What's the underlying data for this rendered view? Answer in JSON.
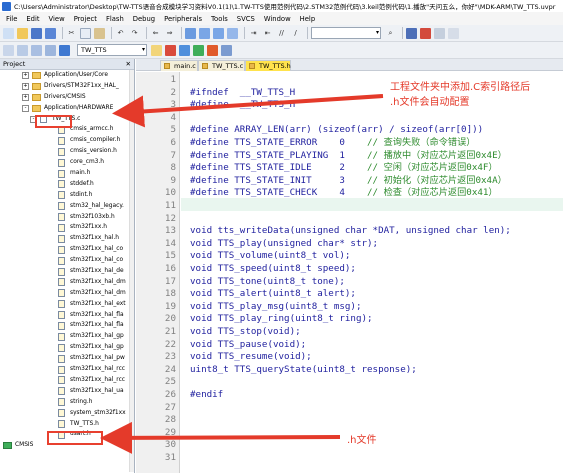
{
  "window": {
    "title": "C:\\Users\\Administrator\\Desktop\\TW-TTS语音合成模块学习资料V0.1(1)\\1.TW-TTS使用范例代码\\2.STM32范例代码\\3.keil范例代码\\1.播放\"天问五么，你好\"\\MDK-ARM\\TW_TTS.uvpr"
  },
  "menu": [
    "File",
    "Edit",
    "View",
    "Project",
    "Flash",
    "Debug",
    "Peripherals",
    "Tools",
    "SVCS",
    "Window",
    "Help"
  ],
  "toolbar": {
    "target": "TW_TTS"
  },
  "project": {
    "title": "Project",
    "items": [
      {
        "label": "Application/User/Core",
        "kind": "folder",
        "level": 2,
        "expander": "+"
      },
      {
        "label": "Drivers/STM32F1xx_HAL_",
        "kind": "folder",
        "level": 2,
        "expander": "+"
      },
      {
        "label": "Drivers/CMSIS",
        "kind": "folder",
        "level": 2,
        "expander": "+"
      },
      {
        "label": "Application/HARDWARE",
        "kind": "folder",
        "level": 2,
        "expander": "-"
      },
      {
        "label": "TW_TTS.c",
        "kind": "file",
        "level": 3,
        "expander": "-"
      },
      {
        "label": "cmsis_armcc.h",
        "kind": "hfile",
        "level": 5
      },
      {
        "label": "cmsis_compiler.h",
        "kind": "hfile",
        "level": 5
      },
      {
        "label": "cmsis_version.h",
        "kind": "hfile",
        "level": 5
      },
      {
        "label": "core_cm3.h",
        "kind": "hfile",
        "level": 5
      },
      {
        "label": "main.h",
        "kind": "hfile",
        "level": 5
      },
      {
        "label": "stddef.h",
        "kind": "hfile",
        "level": 5
      },
      {
        "label": "stdint.h",
        "kind": "hfile",
        "level": 5
      },
      {
        "label": "stm32_hal_legacy.",
        "kind": "hfile",
        "level": 5
      },
      {
        "label": "stm32f103xb.h",
        "kind": "hfile",
        "level": 5
      },
      {
        "label": "stm32f1xx.h",
        "kind": "hfile",
        "level": 5
      },
      {
        "label": "stm32f1xx_hal.h",
        "kind": "hfile",
        "level": 5
      },
      {
        "label": "stm32f1xx_hal_co",
        "kind": "hfile",
        "level": 5
      },
      {
        "label": "stm32f1xx_hal_co",
        "kind": "hfile",
        "level": 5
      },
      {
        "label": "stm32f1xx_hal_de",
        "kind": "hfile",
        "level": 5
      },
      {
        "label": "stm32f1xx_hal_dm",
        "kind": "hfile",
        "level": 5
      },
      {
        "label": "stm32f1xx_hal_dm",
        "kind": "hfile",
        "level": 5
      },
      {
        "label": "stm32f1xx_hal_ext",
        "kind": "hfile",
        "level": 5
      },
      {
        "label": "stm32f1xx_hal_fla",
        "kind": "hfile",
        "level": 5
      },
      {
        "label": "stm32f1xx_hal_fla",
        "kind": "hfile",
        "level": 5
      },
      {
        "label": "stm32f1xx_hal_gp",
        "kind": "hfile",
        "level": 5
      },
      {
        "label": "stm32f1xx_hal_gp",
        "kind": "hfile",
        "level": 5
      },
      {
        "label": "stm32f1xx_hal_pw",
        "kind": "hfile",
        "level": 5
      },
      {
        "label": "stm32f1xx_hal_rcc",
        "kind": "hfile",
        "level": 5
      },
      {
        "label": "stm32f1xx_hal_rcc",
        "kind": "hfile",
        "level": 5
      },
      {
        "label": "stm32f1xx_hal_ua",
        "kind": "hfile",
        "level": 5
      },
      {
        "label": "string.h",
        "kind": "hfile",
        "level": 5
      },
      {
        "label": "system_stm32f1xx",
        "kind": "hfile",
        "level": 5
      },
      {
        "label": "TW_TTS.h",
        "kind": "hfile",
        "level": 5
      },
      {
        "label": "usart.h",
        "kind": "hfile",
        "level": 5
      },
      {
        "label": "CMSIS",
        "kind": "gem",
        "level": 1
      }
    ]
  },
  "tabs": [
    {
      "label": "main.c",
      "active": false
    },
    {
      "label": "TW_TTS.c",
      "active": false
    },
    {
      "label": "TW_TTS.h",
      "active": true
    }
  ],
  "code": [
    {
      "n": "1",
      "t": ""
    },
    {
      "n": "2",
      "t": "#ifndef  __TW_TTS_H"
    },
    {
      "n": "3",
      "t": "#define  __TW_TTS_H"
    },
    {
      "n": "4",
      "t": ""
    },
    {
      "n": "5",
      "t": "#define ARRAY_LEN(arr) (sizeof(arr) / sizeof(arr[0]))"
    },
    {
      "n": "6",
      "t": "#define TTS_STATE_ERROR    0    // 查询失败（命令错误）"
    },
    {
      "n": "7",
      "t": "#define TTS_STATE_PLAYING  1    // 播放中（对应芯片返回0x4E）"
    },
    {
      "n": "8",
      "t": "#define TTS_STATE_IDLE     2    // 空闲（对应芯片返回0x4F）"
    },
    {
      "n": "9",
      "t": "#define TTS_STATE_INIT     3    // 初始化（对应芯片返回0x4A）"
    },
    {
      "n": "10",
      "t": "#define TTS_STATE_CHECK    4    // 检查（对应芯片返回0x41）"
    },
    {
      "n": "11",
      "t": ""
    },
    {
      "n": "12",
      "t": ""
    },
    {
      "n": "13",
      "t": "void tts_writeData(unsigned char *DAT, unsigned char len);"
    },
    {
      "n": "14",
      "t": "void TTS_play(unsigned char* str);"
    },
    {
      "n": "15",
      "t": "void TTS_volume(uint8_t vol);"
    },
    {
      "n": "16",
      "t": "void TTS_speed(uint8_t speed);"
    },
    {
      "n": "17",
      "t": "void TTS_tone(uint8_t tone);"
    },
    {
      "n": "18",
      "t": "void TTS_alert(uint8_t alert);"
    },
    {
      "n": "19",
      "t": "void TTS_play_msg(uint8_t msg);"
    },
    {
      "n": "20",
      "t": "void TTS_play_ring(uint8_t ring);"
    },
    {
      "n": "21",
      "t": "void TTS_stop(void);"
    },
    {
      "n": "22",
      "t": "void TTS_pause(void);"
    },
    {
      "n": "23",
      "t": "void TTS_resume(void);"
    },
    {
      "n": "24",
      "t": "uint8_t TTS_queryState(uint8_t response);"
    },
    {
      "n": "25",
      "t": ""
    },
    {
      "n": "26",
      "t": "#endif"
    },
    {
      "n": "27",
      "t": ""
    },
    {
      "n": "28",
      "t": ""
    },
    {
      "n": "29",
      "t": ""
    },
    {
      "n": "30",
      "t": ""
    },
    {
      "n": "31",
      "t": ""
    }
  ],
  "annotations": {
    "note1_line1": "工程文件夹中添加.C索引路径后",
    "note1_line2": ".h文件会自动配置",
    "note2": ".h文件"
  },
  "colors": {
    "annotation": "#e43a2a",
    "active_tab": "#ffe34d",
    "cursor_line": "#e9f6ef"
  }
}
